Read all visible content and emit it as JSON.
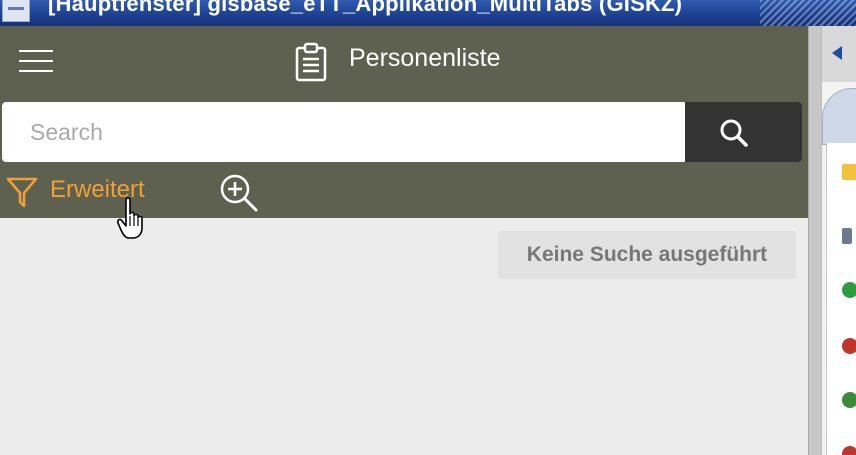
{
  "window": {
    "title": "[Hauptfenster]  gisbase_eTT_Applikation_MultiTabs (GISKZ)"
  },
  "header": {
    "menu_icon": "hamburger-icon",
    "title_icon": "clipboard-icon",
    "title": "Personenliste"
  },
  "search": {
    "placeholder": "Search",
    "value": "",
    "button_icon": "search-icon"
  },
  "filters": {
    "advanced_icon": "funnel-icon",
    "advanced_label": "Erweitert",
    "zoom_icon": "zoom-in-icon"
  },
  "results": {
    "status": "Keine Suche ausgeführt"
  },
  "colors": {
    "header_bg": "#5e6050",
    "accent_orange": "#f0a034",
    "search_button_bg": "#333333",
    "content_bg": "#ececec"
  }
}
